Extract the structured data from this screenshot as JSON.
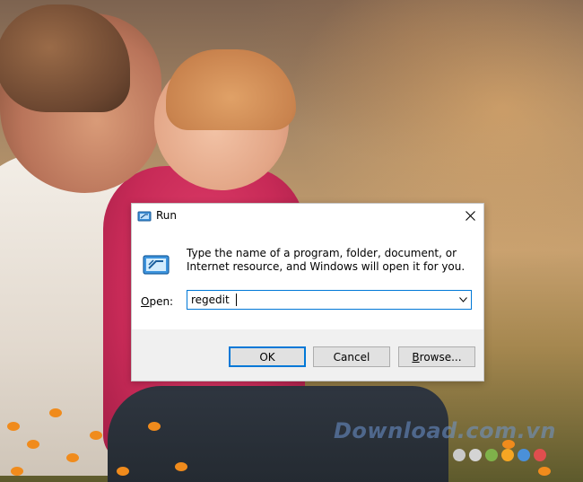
{
  "desktop": {
    "watermark": "Download.com.vn",
    "watermark_dot_colors": [
      "#c9c9c9",
      "#d4d4d4",
      "#7fb24a",
      "#f5a623",
      "#4a90d9",
      "#e04e4e"
    ]
  },
  "run_dialog": {
    "title": "Run",
    "title_icon": "run-icon",
    "close_icon": "close-icon",
    "description": "Type the name of a program, folder, document, or Internet resource, and Windows will open it for you.",
    "open_label_mnemonic": "O",
    "open_label_rest": "pen:",
    "open_value": "regedit",
    "dropdown_icon": "chevron-down-icon",
    "buttons": {
      "ok": "OK",
      "cancel": "Cancel",
      "browse_mnemonic": "B",
      "browse_rest": "rowse..."
    },
    "accent_color": "#0078d7"
  }
}
